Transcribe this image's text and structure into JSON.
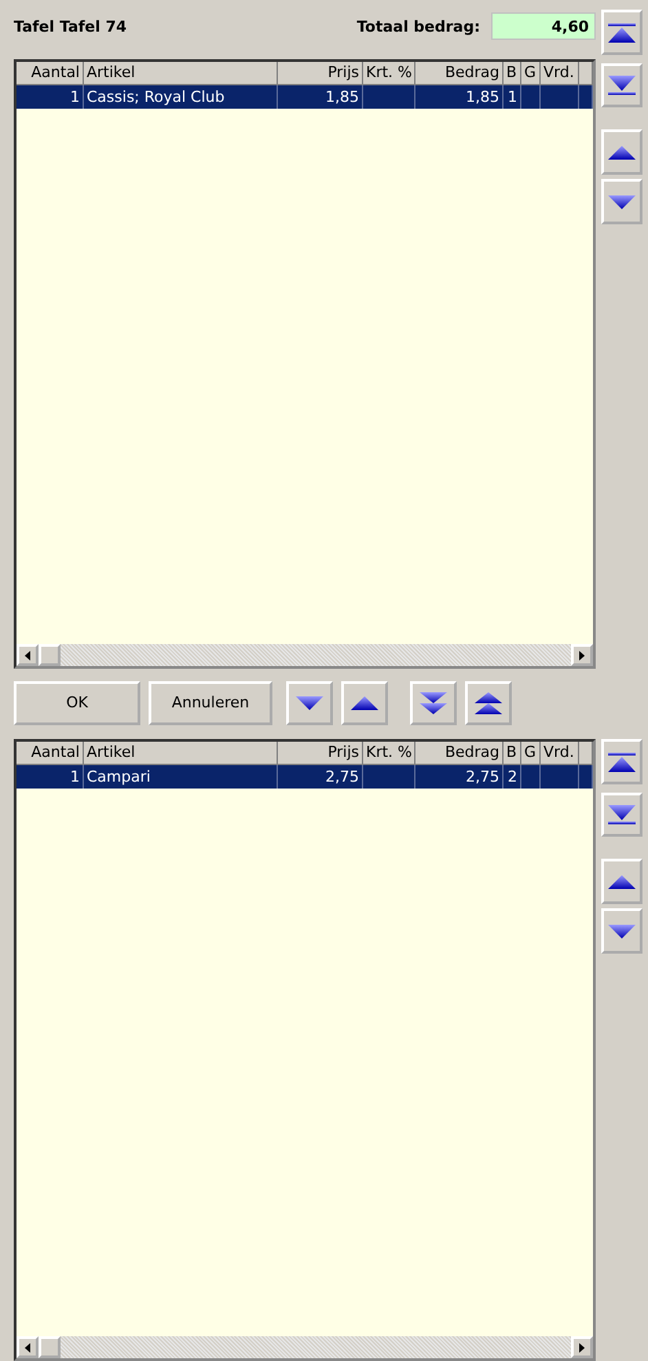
{
  "header": {
    "title": "Tafel Tafel 74",
    "total_label": "Totaal bedrag:",
    "total_value": "4,60"
  },
  "grids": [
    {
      "columns": [
        "Aantal",
        "Artikel",
        "Prijs",
        "Krt. %",
        "Bedrag",
        "B",
        "G",
        "Vrd."
      ],
      "rows": [
        {
          "cells": [
            "1",
            "Cassis; Royal Club",
            "1,85",
            "",
            "1,85",
            "1",
            "",
            ""
          ],
          "selected": true
        }
      ],
      "side_buttons": [
        {
          "kind": "first"
        },
        {
          "kind": "last"
        },
        {
          "kind": "up"
        },
        {
          "kind": "down"
        }
      ]
    },
    {
      "columns": [
        "Aantal",
        "Artikel",
        "Prijs",
        "Krt. %",
        "Bedrag",
        "B",
        "G",
        "Vrd."
      ],
      "rows": [
        {
          "cells": [
            "1",
            "Campari",
            "2,75",
            "",
            "2,75",
            "2",
            "",
            ""
          ],
          "selected": true
        }
      ],
      "side_buttons": [
        {
          "kind": "first"
        },
        {
          "kind": "last"
        },
        {
          "kind": "up"
        },
        {
          "kind": "down"
        }
      ]
    }
  ],
  "actions": [
    {
      "kind": "text",
      "label": "OK"
    },
    {
      "kind": "text",
      "label": "Annuleren"
    },
    {
      "kind": "down"
    },
    {
      "kind": "up"
    },
    {
      "kind": "double-down"
    },
    {
      "kind": "double-up"
    }
  ]
}
